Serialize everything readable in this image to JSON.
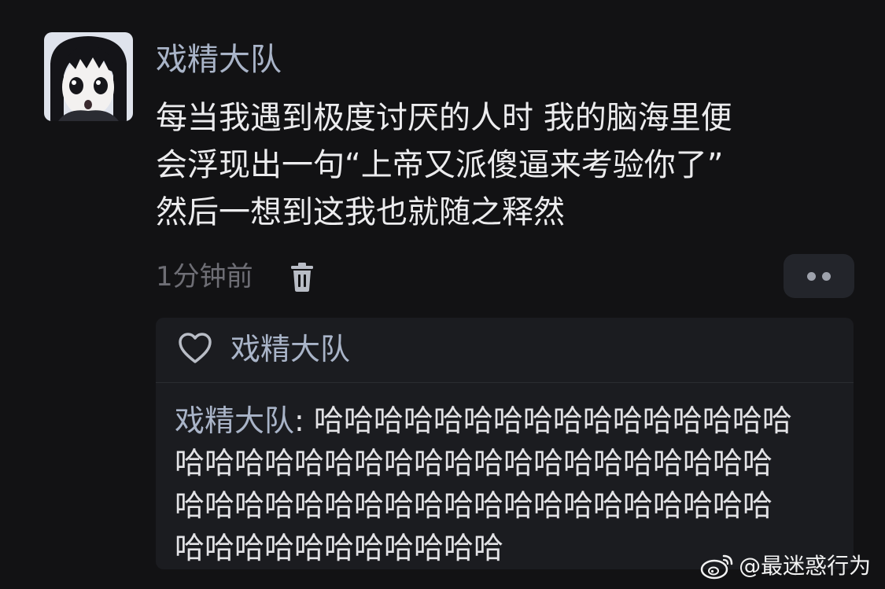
{
  "post": {
    "avatar_icon": "anime-girl-avatar",
    "username": "戏精大队",
    "text_lines": [
      "每当我遇到极度讨厌的人时 我的脑海里便",
      "会浮现出一句“上帝又派傻逼来考验你了”",
      "然后一想到这我也就随之释然"
    ],
    "time": "1分钟前",
    "delete_icon": "trash-icon",
    "more_icon": "more-dots-icon"
  },
  "reply_box": {
    "like_icon": "heart-icon",
    "liker": "戏精大队",
    "comment": {
      "author": "戏精大队",
      "line1_rest": ": 哈哈哈哈哈哈哈哈哈哈哈哈哈哈哈哈",
      "line2": "哈哈哈哈哈哈哈哈哈哈哈哈哈哈哈哈哈哈哈哈",
      "line3": "哈哈哈哈哈哈哈哈哈哈哈哈哈哈哈哈哈哈哈哈",
      "line4": "哈哈哈哈哈哈哈哈哈哈哈"
    }
  },
  "watermark": {
    "icon": "weibo-logo-icon",
    "text": "@最迷惑行为"
  },
  "colors": {
    "background": "#121214",
    "username": "#a9b4c8",
    "time": "#6e6e75",
    "reply_box": "#1b1c20"
  }
}
